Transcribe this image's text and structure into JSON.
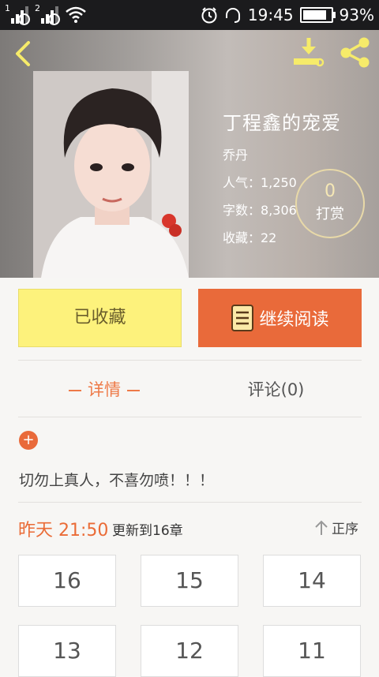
{
  "status_bar": {
    "sim1": "1",
    "sim2": "2",
    "time": "19:45",
    "battery": "93%",
    "battery_level": 0.93
  },
  "book": {
    "title": "丁程鑫的宠爱",
    "author": "乔丹",
    "popularity": "人气：1,250",
    "word_count": "字数：8,306",
    "favorites": "收藏：22"
  },
  "reward": {
    "count": "0",
    "label": "打赏"
  },
  "actions": {
    "favorited_label": "已收藏",
    "continue_label": "继续阅读"
  },
  "tabs": {
    "detail": "详情",
    "comments": "评论(0)"
  },
  "description": "切勿上真人，不喜勿喷！！！",
  "update": {
    "time": "昨天 21:50",
    "text": "更新到16章",
    "sort_label": "正序"
  },
  "chapters": [
    "16",
    "15",
    "14",
    "13",
    "12",
    "11"
  ],
  "colors": {
    "accent": "#e96a3a",
    "favorite_bg": "#fdf27c",
    "icon_yellow": "#f6eb6a"
  },
  "icons": [
    "back-arrow-icon",
    "download-icon",
    "share-icon",
    "book-icon",
    "plus-icon",
    "arrow-up-icon",
    "clock-icon",
    "headset-icon",
    "wifi-icon"
  ]
}
